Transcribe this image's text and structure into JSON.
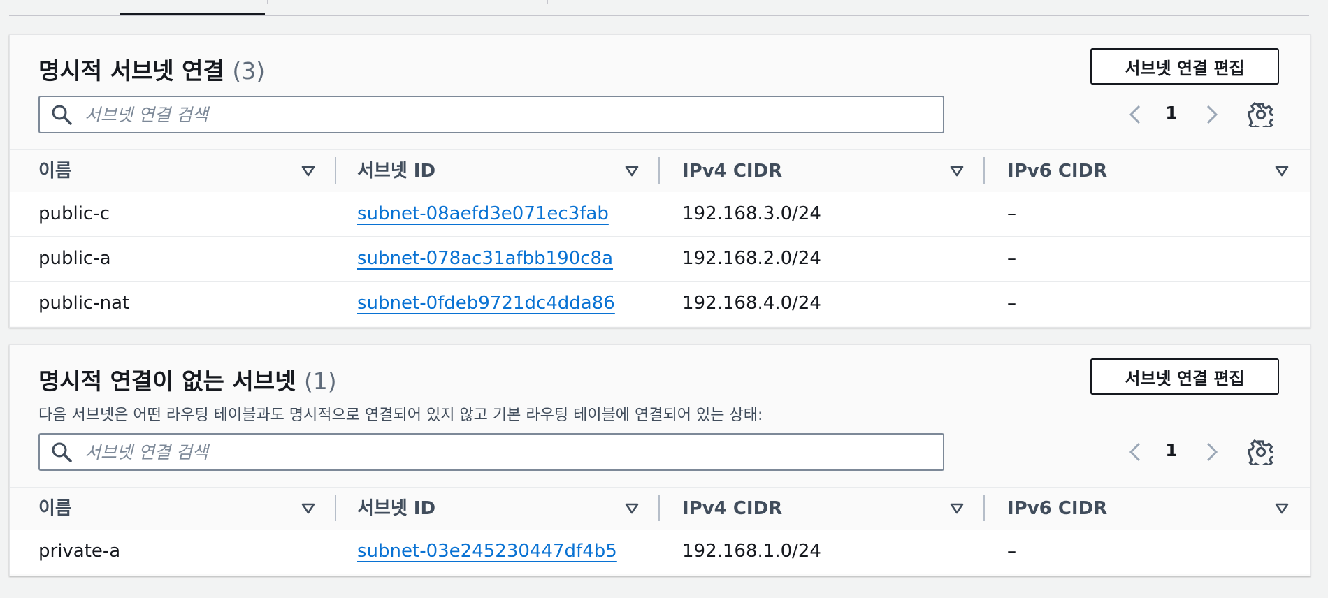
{
  "panels": [
    {
      "title": "명시적 서브넷 연결",
      "count": "(3)",
      "edit_button": "서브넷 연결 편집",
      "search_placeholder": "서브넷 연결 검색",
      "page": "1",
      "columns": [
        "이름",
        "서브넷 ID",
        "IPv4 CIDR",
        "IPv6 CIDR"
      ],
      "rows": [
        {
          "name": "public-c",
          "subnet_id": "subnet-08aefd3e071ec3fab",
          "ipv4": "192.168.3.0/24",
          "ipv6": "–"
        },
        {
          "name": "public-a",
          "subnet_id": "subnet-078ac31afbb190c8a",
          "ipv4": "192.168.2.0/24",
          "ipv6": "–"
        },
        {
          "name": "public-nat",
          "subnet_id": "subnet-0fdeb9721dc4dda86",
          "ipv4": "192.168.4.0/24",
          "ipv6": "–"
        }
      ]
    },
    {
      "title": "명시적 연결이 없는 서브넷",
      "count": "(1)",
      "description": "다음 서브넷은 어떤 라우팅 테이블과도 명시적으로 연결되어 있지 않고 기본 라우팅 테이블에 연결되어 있는 상태:",
      "edit_button": "서브넷 연결 편집",
      "search_placeholder": "서브넷 연결 검색",
      "page": "1",
      "columns": [
        "이름",
        "서브넷 ID",
        "IPv4 CIDR",
        "IPv6 CIDR"
      ],
      "rows": [
        {
          "name": "private-a",
          "subnet_id": "subnet-03e245230447df4b5",
          "ipv4": "192.168.1.0/24",
          "ipv6": "–"
        }
      ]
    }
  ],
  "icons": {
    "search": "search-icon",
    "prev": "chevron-left-icon",
    "next": "chevron-right-icon",
    "settings": "gear-icon",
    "sort": "sort-caret-down-icon"
  },
  "colors": {
    "link": "#0972d3",
    "text": "#16191f",
    "border": "#7d8998",
    "background": "#f2f3f3"
  }
}
